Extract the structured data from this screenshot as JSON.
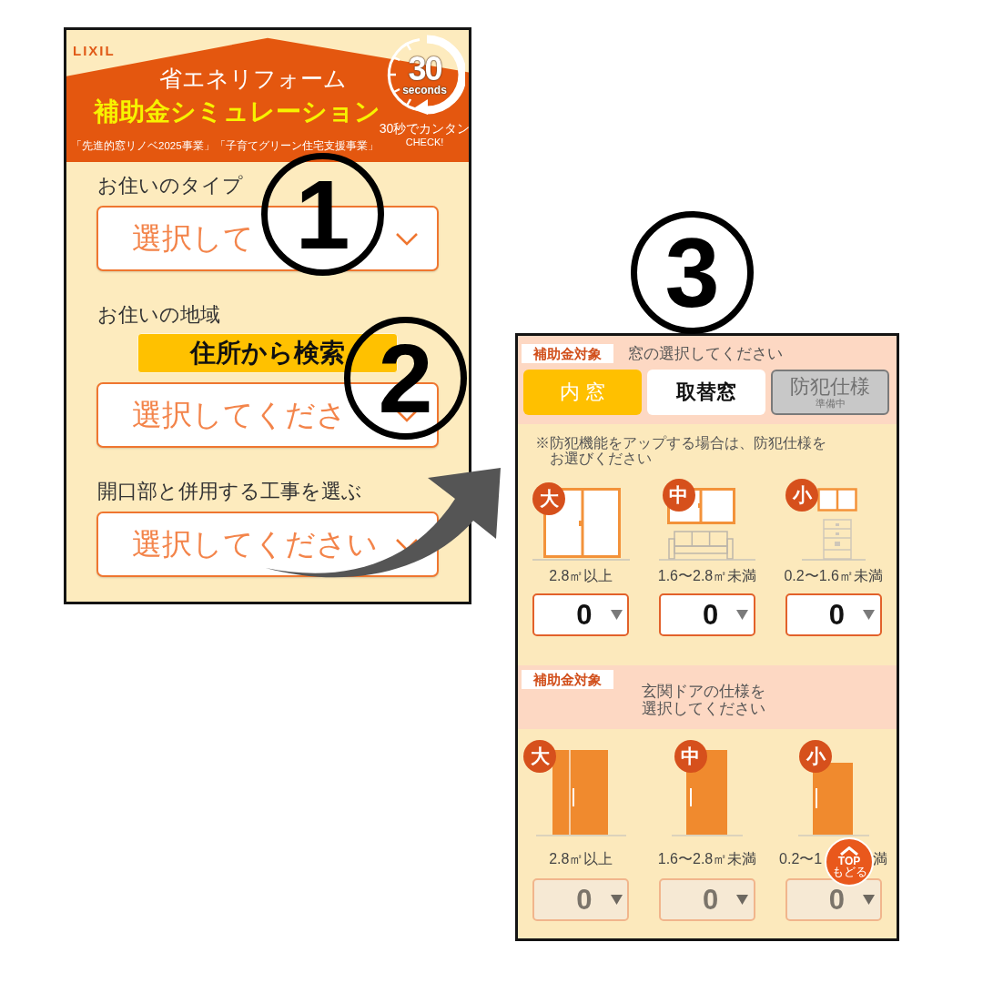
{
  "simulator_screen": {
    "brand": "LIXIL",
    "header": {
      "title": "省エネリフォーム",
      "heading": "補助金シミュレーション",
      "programs": "「先進的窓リノベ2025事業」「子育てグリーン住宅支援事業」",
      "timer_badge": {
        "number": "30",
        "unit": "seconds"
      },
      "caption": "30秒でカンタン",
      "caption_sub": "CHECK!"
    },
    "fields": [
      {
        "label": "お住いのタイプ",
        "placeholder": "選択して"
      },
      {
        "label": "お住いの地域",
        "search_button": "住所から検索",
        "placeholder": "選択してくださ"
      },
      {
        "label": "開口部と併用する工事を選ぶ",
        "placeholder": "選択してください"
      }
    ]
  },
  "step_markers": [
    {
      "number": "1"
    },
    {
      "number": "2"
    },
    {
      "number": "3"
    }
  ],
  "window_screen": {
    "sections": [
      {
        "kind": "window",
        "tag": "補助金対象",
        "title": "窓の選択してください",
        "tabs": [
          {
            "label": "内 窓",
            "selected": true,
            "disabled": false
          },
          {
            "label": "取替窓",
            "selected": false,
            "disabled": false
          },
          {
            "label": "防犯仕様",
            "sublabel": "準備中",
            "selected": false,
            "disabled": true
          }
        ],
        "note": "※防犯機能をアップする場合は、防犯仕様をお選びください",
        "options": [
          {
            "kind": "large",
            "badge": "大",
            "size": "2.8㎡以上",
            "quantity": "0",
            "disabled": false
          },
          {
            "kind": "medium",
            "badge": "中",
            "size": "1.6〜2.8㎡未満",
            "quantity": "0",
            "disabled": false
          },
          {
            "kind": "small",
            "badge": "小",
            "size": "0.2〜1.6㎡未満",
            "quantity": "0",
            "disabled": false
          }
        ]
      },
      {
        "kind": "door",
        "tag": "補助金対象",
        "title": "玄関ドアの仕様を選択してください",
        "options": [
          {
            "kind": "large",
            "badge": "大",
            "size": "2.8㎡以上",
            "quantity": "0",
            "disabled": true
          },
          {
            "kind": "medium",
            "badge": "中",
            "size": "1.6〜2.8㎡未満",
            "quantity": "0",
            "disabled": true
          },
          {
            "kind": "small",
            "badge": "小",
            "size": "0.2〜1",
            "size_tail": "満",
            "quantity": "0",
            "disabled": true
          }
        ]
      }
    ],
    "top_button": {
      "label": "TOP",
      "sublabel": "もどる"
    }
  }
}
